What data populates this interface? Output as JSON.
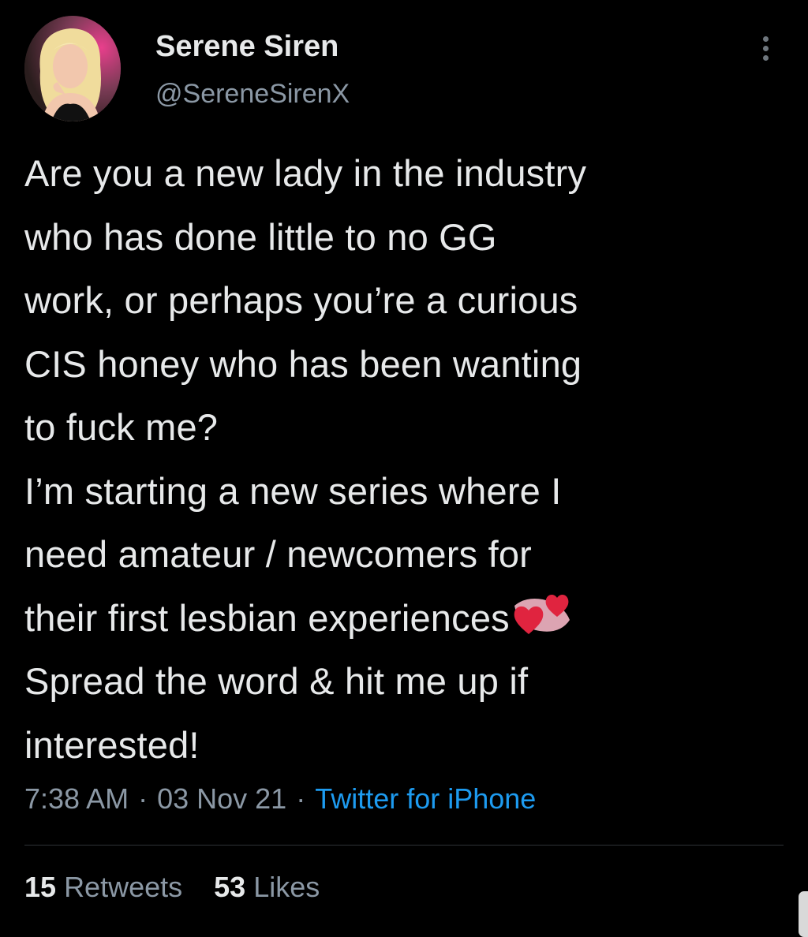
{
  "author": {
    "display_name": "Serene Siren",
    "handle": "@SereneSirenX",
    "avatar_icon": "profile-photo"
  },
  "tweet": {
    "lines": [
      "Are you a new lady in the industry",
      "who has done little to no GG",
      "work, or perhaps you’re a curious",
      "CIS honey who has been wanting",
      "to fuck me?",
      "I’m starting a new series where I",
      "need amateur / newcomers for",
      "their first lesbian experiences",
      "Spread the word & hit me up if",
      "interested!"
    ],
    "emoji_icon": "two-hearts-emoji"
  },
  "meta": {
    "time": "7:38 AM",
    "date": "03 Nov 21",
    "separator": "·",
    "source": "Twitter for iPhone"
  },
  "stats": {
    "retweets_count": "15",
    "retweets_label": "Retweets",
    "likes_count": "53",
    "likes_label": "Likes"
  },
  "colors": {
    "background": "#000000",
    "text": "#e7e9ea",
    "secondary": "#8b98a5",
    "link": "#1d9bf0",
    "divider": "#2f3336"
  }
}
